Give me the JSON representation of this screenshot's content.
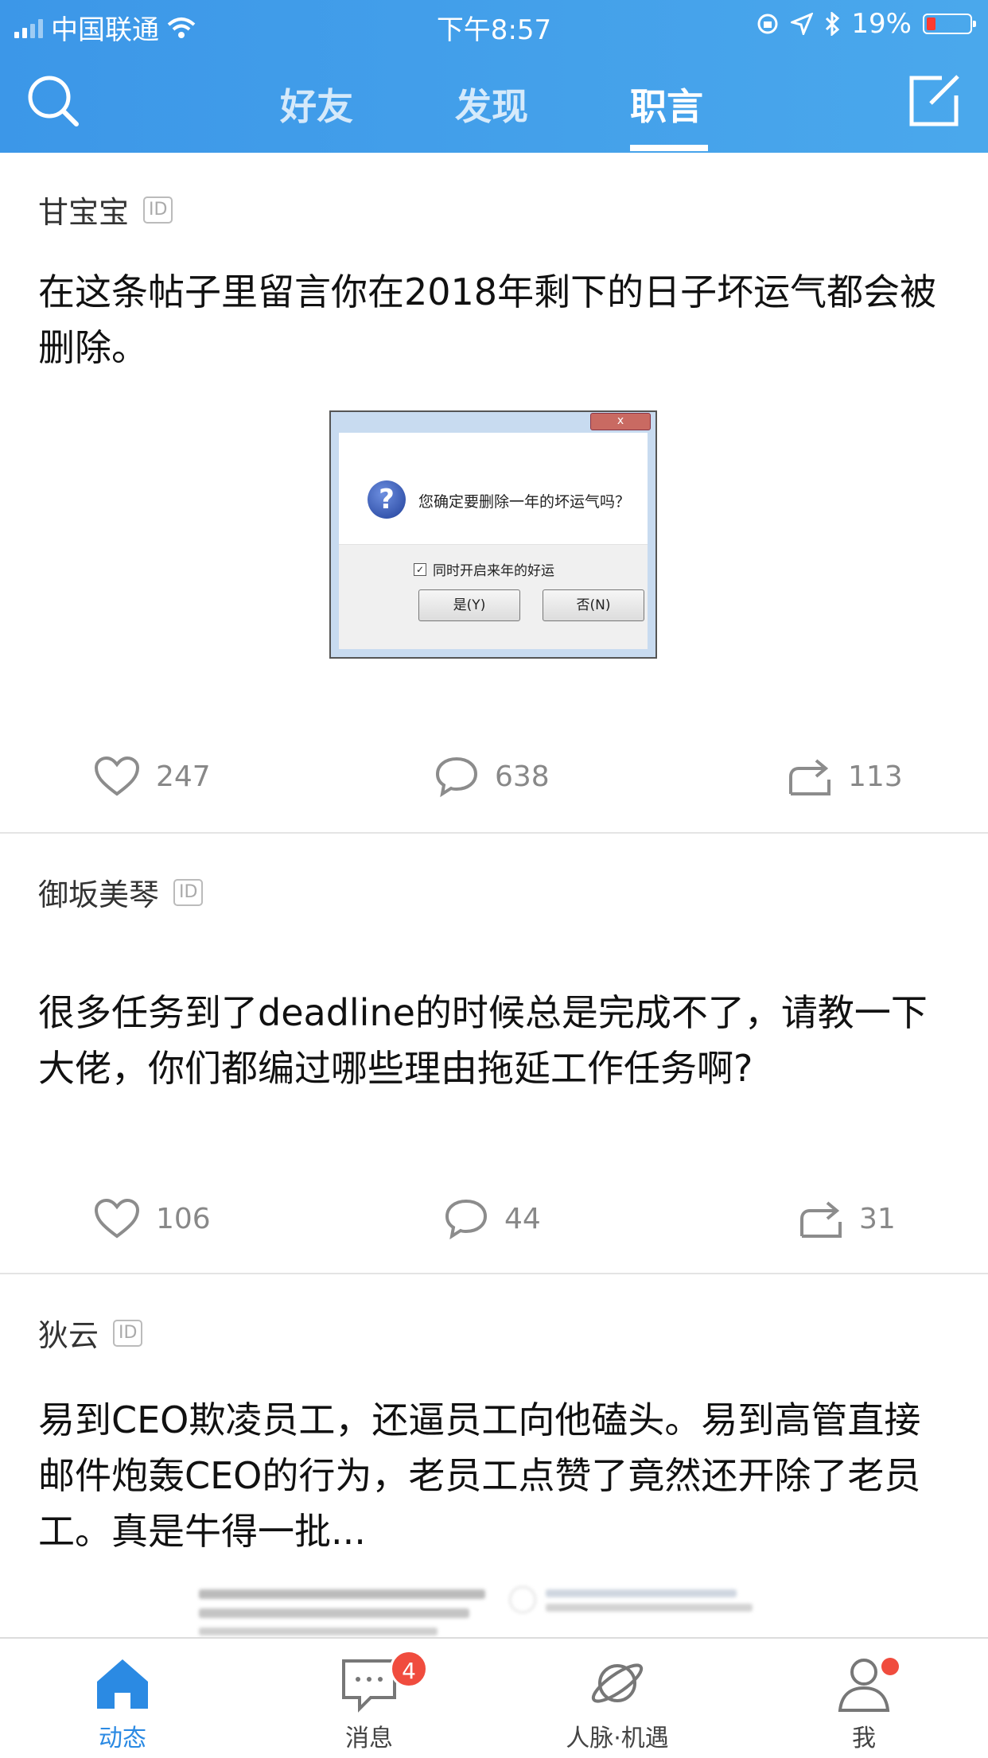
{
  "status_bar": {
    "carrier": "中国联通",
    "time": "下午8:57",
    "battery": "19%"
  },
  "header": {
    "tabs": [
      {
        "label": "好友",
        "active": false
      },
      {
        "label": "发现",
        "active": false
      },
      {
        "label": "职言",
        "active": true
      }
    ]
  },
  "posts": [
    {
      "author": "甘宝宝",
      "id_badge": "ID",
      "content": "在这条帖子里留言你在2018年剩下的日子坏运气都会被删除。",
      "image": {
        "close": "x",
        "message": "您确定要删除一年的坏运气吗？",
        "checkbox_label": "同时开启来年的好运",
        "yes_button": "是(Y)",
        "no_button": "否(N)"
      },
      "likes": "247",
      "comments": "638",
      "shares": "113"
    },
    {
      "author": "御坂美琴",
      "id_badge": "ID",
      "content": "很多任务到了deadline的时候总是完成不了，请教一下大佬，你们都编过哪些理由拖延工作任务啊?",
      "likes": "106",
      "comments": "44",
      "shares": "31"
    },
    {
      "author": "狄云",
      "id_badge": "ID",
      "content": "易到CEO欺凌员工，还逼员工向他磕头。易到高管直接邮件炮轰CEO的行为，老员工点赞了竟然还开除了老员工。真是牛得一批..."
    }
  ],
  "tab_bar": {
    "items": [
      {
        "label": "动态",
        "active": true
      },
      {
        "label": "消息",
        "badge": "4"
      },
      {
        "label": "人脉·机遇"
      },
      {
        "label": "我",
        "dot": true
      }
    ]
  },
  "colors": {
    "header_blue": "#3c97e8",
    "active_tab": "#2b8ae3",
    "badge_red": "#f04c3e"
  }
}
